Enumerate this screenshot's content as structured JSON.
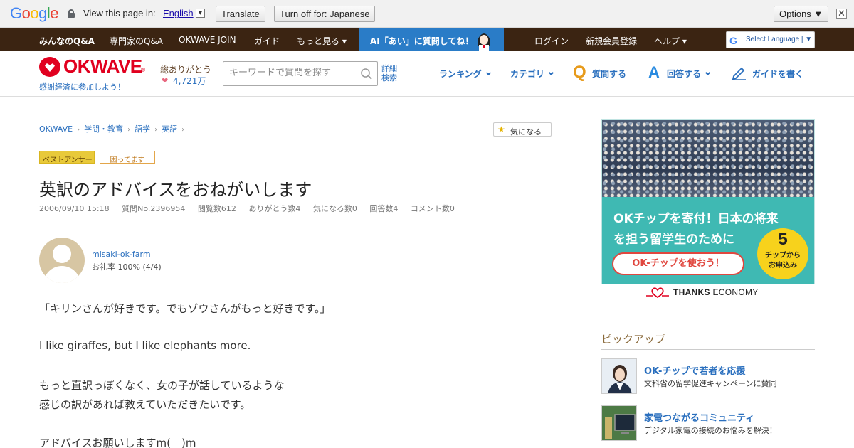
{
  "translate_bar": {
    "logo": "Google",
    "view_text": "View this page in:",
    "language": "English",
    "translate_label": "Translate",
    "turn_off_label": "Turn off for: Japanese",
    "options_label": "Options ▼",
    "close_glyph": "✕"
  },
  "top_nav": {
    "items": [
      "みんなのQ&A",
      "専門家のQ&A",
      "OKWAVE JOIN",
      "ガイド",
      "もっと見る ▾"
    ],
    "ai_banner": "AI「あい」に質問してね！",
    "right_items": [
      "ログイン",
      "新規会員登録",
      "ヘルプ ▾"
    ],
    "translate_widget": "Select Language | ▼"
  },
  "header": {
    "logo": "OKWAVE",
    "registered_mark": "®",
    "tagline": "感謝経済に参加しよう！",
    "thanks_label": "総ありがとう",
    "thanks_count": "4,721万",
    "search_placeholder": "キーワードで質問を探す",
    "advanced_search_1": "詳細",
    "advanced_search_2": "検索",
    "nav": {
      "ranking": "ランキング",
      "category": "カテゴリ",
      "ask": "質問する",
      "answer": "回答する",
      "write_guide": "ガイドを書く"
    }
  },
  "breadcrumb": [
    "OKWAVE",
    "学問・教育",
    "語学",
    "英語"
  ],
  "favorite_label": "気になる",
  "badges": {
    "best": "ベストアンサー",
    "trouble": "困ってます"
  },
  "question": {
    "title": "英訳のアドバイスをおねがいします",
    "meta": [
      "2006/09/10 15:18",
      "質問No.2396954",
      "閲覧数612",
      "ありがとう数4",
      "気になる数0",
      "回答数4",
      "コメント数0"
    ],
    "user_name": "misaki-ok-farm",
    "user_rate": "お礼率 100%  (4/4)",
    "body": [
      "「キリンさんが好きです。でもゾウさんがもっと好きです。」",
      "I like giraffes, but I like elephants more.",
      "もっと直訳っぽくなく、女の子が話しているような",
      "感じの訳があれば教えていただきたいです。",
      "アドバイスお願いしますm(__)m"
    ]
  },
  "ad": {
    "line1": "OKチップを寄付！日本の将来",
    "line2": "を担う留学生のために",
    "button": "OK-チップを使おう！",
    "circle_num": "5",
    "circle_sub1": "チップから",
    "circle_sub2": "お申込み",
    "thanks_economy_1": "THANKS",
    "thanks_economy_2": " ECONOMY"
  },
  "pickup": {
    "heading": "ピックアップ",
    "items": [
      {
        "title": "OK-チップで若者を応援",
        "desc": "文科省の留学促進キャンペーンに賛同"
      },
      {
        "title": "家電つながるコミュニティ",
        "desc": "デジタル家電の接続のお悩みを解決！"
      }
    ]
  },
  "colors": {
    "brand_red": "#e1001f",
    "link_blue": "#2a6fbe",
    "nav_brown": "#3b2412",
    "ai_blue": "#2a7cc7",
    "ad_teal": "#3fb9b3"
  }
}
